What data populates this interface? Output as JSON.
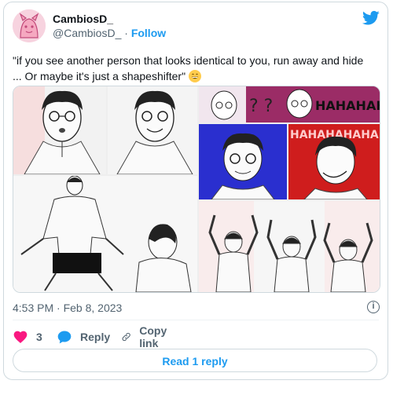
{
  "tweet": {
    "author_name": "CambiosD_",
    "author_handle": "@CambiosD_",
    "separator": "·",
    "follow_label": "Follow",
    "text": "\"if you see another person that looks identical to you, run away and hide ... Or maybe it's just a shapeshifter\"",
    "timestamp": "4:53 PM · Feb 8, 2023",
    "like_count": "3",
    "reply_label": "Reply",
    "copy_link_label": "Copy link",
    "read_replies_label": "Read 1 reply"
  },
  "media": {
    "bubble_text": "HAHAHAHAHA",
    "question_marks": "? ?"
  },
  "icons": [
    "twitter-bird-icon",
    "heart-icon",
    "reply-bubble-icon",
    "link-icon",
    "info-icon",
    "grin-emoji"
  ],
  "colors": {
    "accent": "#1d9bf0",
    "like": "#f91880",
    "muted": "#536471",
    "border": "#cfd9de"
  }
}
